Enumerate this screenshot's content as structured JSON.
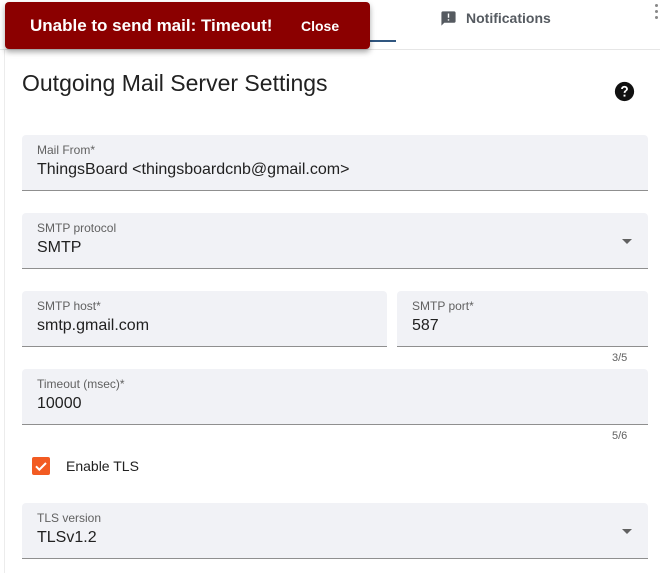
{
  "snackbar": {
    "message": "Unable to send mail: Timeout!",
    "close_label": "Close"
  },
  "tabs": {
    "notifications_label": "Notifications"
  },
  "page": {
    "title": "Outgoing Mail Server Settings"
  },
  "form": {
    "mail_from": {
      "label": "Mail From*",
      "value": "ThingsBoard <thingsboardcnb@gmail.com>"
    },
    "smtp_protocol": {
      "label": "SMTP protocol",
      "value": "SMTP"
    },
    "smtp_host": {
      "label": "SMTP host*",
      "value": "smtp.gmail.com"
    },
    "smtp_port": {
      "label": "SMTP port*",
      "value": "587",
      "counter": "3/5"
    },
    "timeout": {
      "label": "Timeout (msec)*",
      "value": "10000",
      "counter": "5/6"
    },
    "enable_tls": {
      "label": "Enable TLS",
      "checked": true
    },
    "tls_version": {
      "label": "TLS version",
      "value": "TLSv1.2"
    }
  },
  "colors": {
    "error": "#8b0000",
    "accent": "#f25b22",
    "primary": "#305680",
    "field_bg": "#f1f2f6"
  },
  "icons": {
    "help": "help-circle-icon",
    "notifications": "announcement-icon",
    "dropdown": "arrow-drop-down-icon",
    "check": "check-icon"
  }
}
